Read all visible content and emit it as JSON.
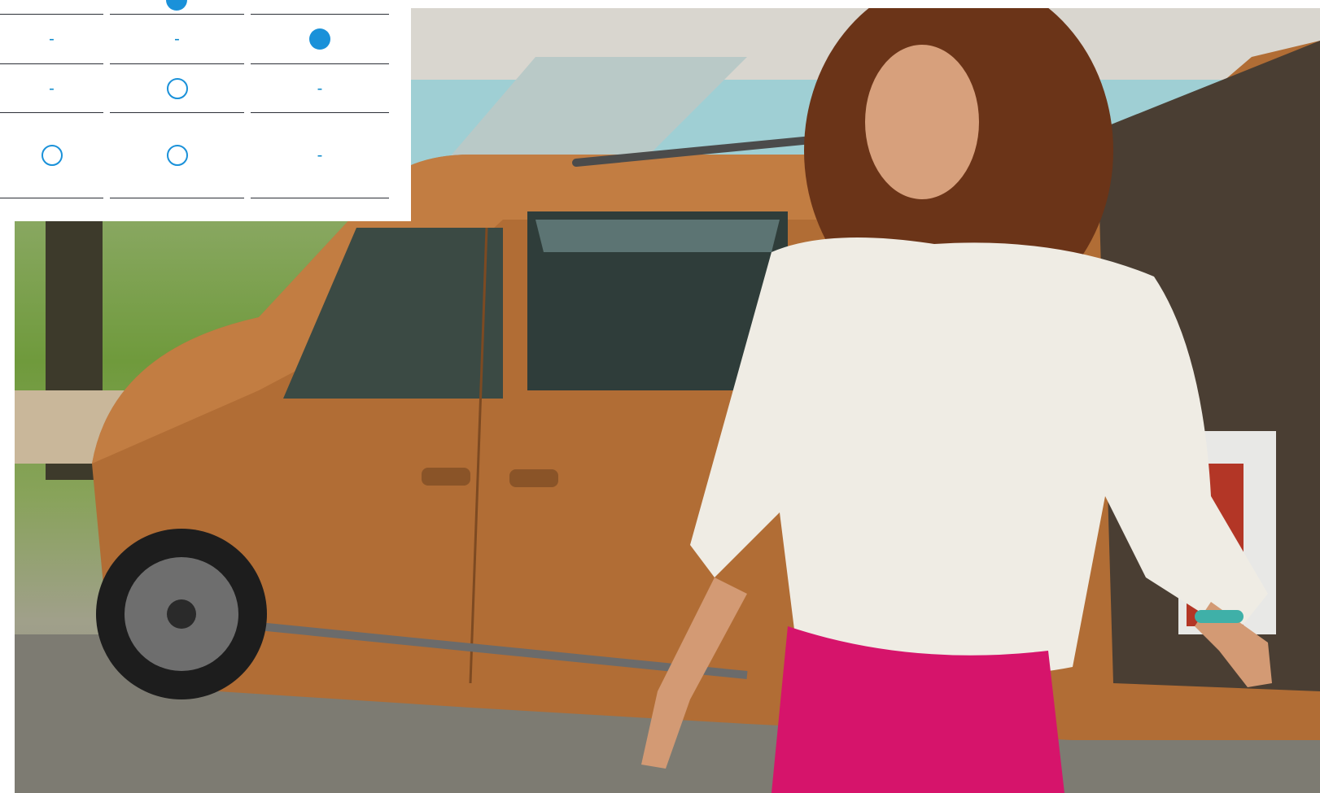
{
  "comparison_table": {
    "colors": {
      "accent": "#1a91d9",
      "dash": "#0e8bcc",
      "rule": "#2b2f36"
    },
    "rows": [
      {
        "cells": [
          {
            "type": "none"
          },
          {
            "type": "filled"
          },
          {
            "type": "none"
          }
        ]
      },
      {
        "cells": [
          {
            "type": "dash",
            "text": "-"
          },
          {
            "type": "dash",
            "text": "-"
          },
          {
            "type": "filled"
          }
        ]
      },
      {
        "cells": [
          {
            "type": "dash",
            "text": "-"
          },
          {
            "type": "open"
          },
          {
            "type": "dash",
            "text": "-"
          }
        ]
      },
      {
        "cells": [
          {
            "type": "open"
          },
          {
            "type": "open"
          },
          {
            "type": "dash",
            "text": "-"
          }
        ]
      }
    ]
  },
  "hero_image": {
    "icon": "photo-woman-with-copper-van"
  }
}
